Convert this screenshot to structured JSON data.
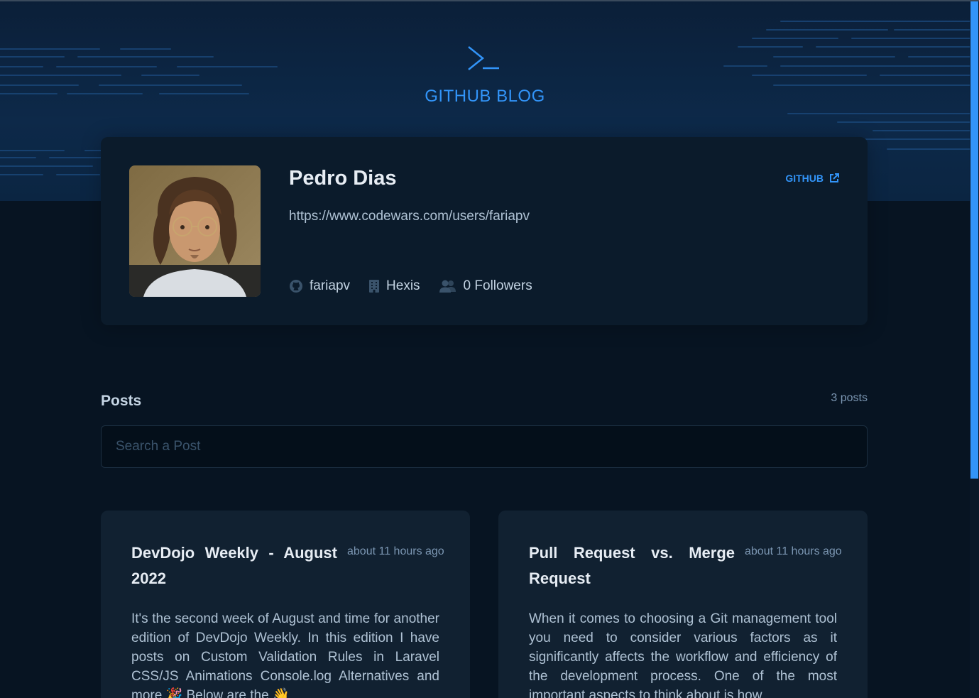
{
  "header": {
    "brand": "GITHUB BLOG",
    "logo_icon": "terminal-icon"
  },
  "profile": {
    "name": "Pedro Dias",
    "github_link_label": "GITHUB",
    "github_link_icon": "external-link-icon",
    "bio": "https://www.codewars.com/users/fariapv",
    "username": "fariapv",
    "company": "Hexis",
    "followers": "0 Followers"
  },
  "posts": {
    "title": "Posts",
    "count": "3 posts",
    "search_placeholder": "Search a Post",
    "items": [
      {
        "title": "DevDojo Weekly - August 2022",
        "date": "about 11 hours ago",
        "excerpt": "It's the second week of August and time for another edition of DevDojo Weekly. In this edition I have posts on Custom Validation Rules in Laravel CSS/JS Animations Console.log Alternatives and more 🎉 Below are the 👋"
      },
      {
        "title": "Pull Request vs. Merge Request",
        "date": "about 11 hours ago",
        "excerpt": "When it comes to choosing a Git management tool you need to consider various factors as it significantly affects the workflow and efficiency of the development process. One of the most important aspects to think about is how"
      }
    ]
  },
  "colors": {
    "accent": "#3294F8",
    "background": "#071422",
    "profile_bg": "#0B1B2B",
    "card_bg": "#112131",
    "input_bg": "#040F1A"
  }
}
